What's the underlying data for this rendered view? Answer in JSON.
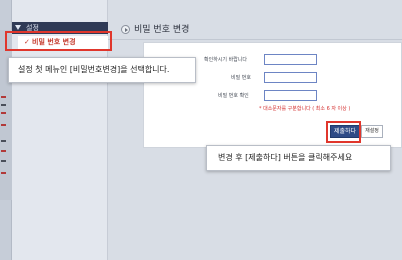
{
  "sidebar": {
    "section_label": "설정",
    "active_item": {
      "label": "비밀 번호 변경"
    }
  },
  "page": {
    "title": "비밀 번호 변경"
  },
  "form": {
    "current_password_label": "확인하시기 바랍니다",
    "new_password_label": "비밀 번호",
    "confirm_password_label": "비밀 번호 확인",
    "current_password_value": "",
    "new_password_value": "",
    "confirm_password_value": "",
    "note": "* 대소문자를 구분합니다 ( 최소 6 자 이상 )"
  },
  "buttons": {
    "submit_label": "제출하다",
    "reset_label": "재설정"
  },
  "callouts": {
    "step1": "설정 첫 메뉴인 [비밀번호변경]을 선택합니다.",
    "step2": "변경 후 [제출하다] 버튼을 클릭해주세요"
  },
  "colors": {
    "highlight": "#e0362c",
    "sidebar_header": "#2f3a56",
    "submit_button": "#2e4b86",
    "note_text": "#d42f2f",
    "active_menu_text": "#c43a2c"
  }
}
